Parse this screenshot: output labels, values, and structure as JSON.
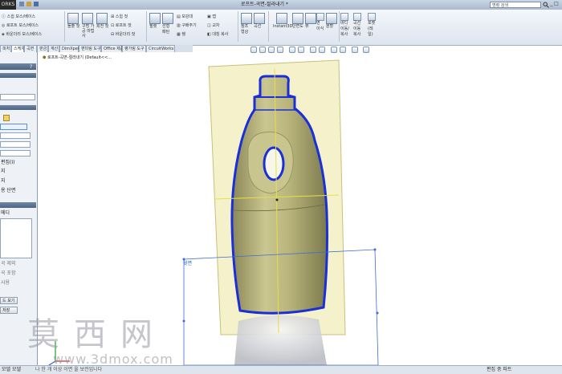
{
  "app": {
    "logo_text": "ORKS",
    "doc_title": "로프트-곡면-절라내기 *",
    "search_placeholder": "명령 검색"
  },
  "window": {
    "minimize": "_",
    "maximize": "□",
    "close": "×"
  },
  "ribbon": {
    "group1": [
      "스윕 보스/베이스",
      "로프트 보스/베이스",
      "바운더리 보스/베이스"
    ],
    "group1_big": [
      "돌출",
      "회전"
    ],
    "group2_big": [
      "돌출 컷",
      "구멍 가공 마법사",
      "회전 컷"
    ],
    "group2": [
      "스윕 컷",
      "로프트 컷",
      "바운더리 컷"
    ],
    "group3": [
      "필렛",
      "선형 패턴"
    ],
    "group4": [
      "보강대",
      "구배주기",
      "쉘"
    ],
    "group5": [
      "랩",
      "교차",
      "대칭 복사"
    ],
    "group6": [
      "참조 형상",
      "곡선"
    ],
    "group7": [
      "Instant3D",
      "단면도",
      "뷰",
      "면 이식",
      "분할"
    ],
    "group8": [
      "바디 이동/복사",
      "곡선 이동 복사",
      "포켓 (레일)",
      "회전"
    ]
  },
  "tabs": [
    "피처",
    "스케치",
    "곡면",
    "판금",
    "계산",
    "DimXpert",
    "편미링 도구",
    "Office 제품",
    "평가링 도구",
    "CircuitWorks"
  ],
  "active_tab_index": 1,
  "left_panel": {
    "title_mark": "?",
    "items": [
      "편집(I)",
      "지",
      "지",
      "용 단면",
      "메디"
    ],
    "labels_lower": [
      "곡 제외",
      "곡 포함",
      "사용"
    ],
    "buttons": [
      "드 보기",
      "저장"
    ]
  },
  "tree": {
    "label": "로프트-곡면-절라내기 (Default<<..."
  },
  "viewport": {
    "plane_label": "윗면"
  },
  "status": {
    "left": "모델  모델",
    "message": "나 한 개 이상 이면 올 보전입니다",
    "right": "편집 중  파트"
  },
  "watermark": {
    "chinese": "莫西网",
    "url": "www.3dmox.com"
  },
  "colors": {
    "bottle_fill": "#b5b27a",
    "plane_fill": "#f3f0c2",
    "outline": "#1a2fd8",
    "sketch_plane": "#3a6fd0"
  },
  "icons": [
    "search-icon",
    "zoom-icon",
    "rotate-icon",
    "section-view-icon",
    "display-style-icon",
    "appearance-icon",
    "scene-icon"
  ]
}
